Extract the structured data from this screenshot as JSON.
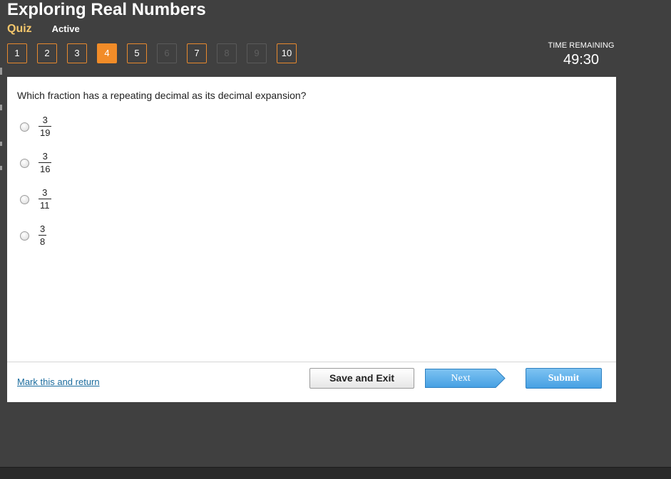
{
  "header": {
    "title": "Exploring Real Numbers",
    "quiz_label": "Quiz",
    "status": "Active"
  },
  "question_nav": [
    {
      "label": "1",
      "state": "answered"
    },
    {
      "label": "2",
      "state": "answered"
    },
    {
      "label": "3",
      "state": "answered"
    },
    {
      "label": "4",
      "state": "current"
    },
    {
      "label": "5",
      "state": "answered"
    },
    {
      "label": "6",
      "state": "disabled"
    },
    {
      "label": "7",
      "state": "answered"
    },
    {
      "label": "8",
      "state": "disabled"
    },
    {
      "label": "9",
      "state": "disabled"
    },
    {
      "label": "10",
      "state": "answered"
    }
  ],
  "timer": {
    "label": "TIME REMAINING",
    "value": "49:30"
  },
  "question": {
    "text": "Which fraction has a repeating decimal as its decimal expansion?",
    "options": [
      {
        "numerator": "3",
        "denominator": "19"
      },
      {
        "numerator": "3",
        "denominator": "16"
      },
      {
        "numerator": "3",
        "denominator": "11"
      },
      {
        "numerator": "3",
        "denominator": "8"
      }
    ]
  },
  "footer": {
    "mark_link": "Mark this and return",
    "save_label": "Save and Exit",
    "next_label": "Next",
    "submit_label": "Submit"
  },
  "colors": {
    "accent": "#f28c28",
    "background": "#404040",
    "primary_button": "#46a0e3"
  },
  "icons": {
    "radio": "radio-button-icon",
    "next": "arrow-right-icon"
  }
}
